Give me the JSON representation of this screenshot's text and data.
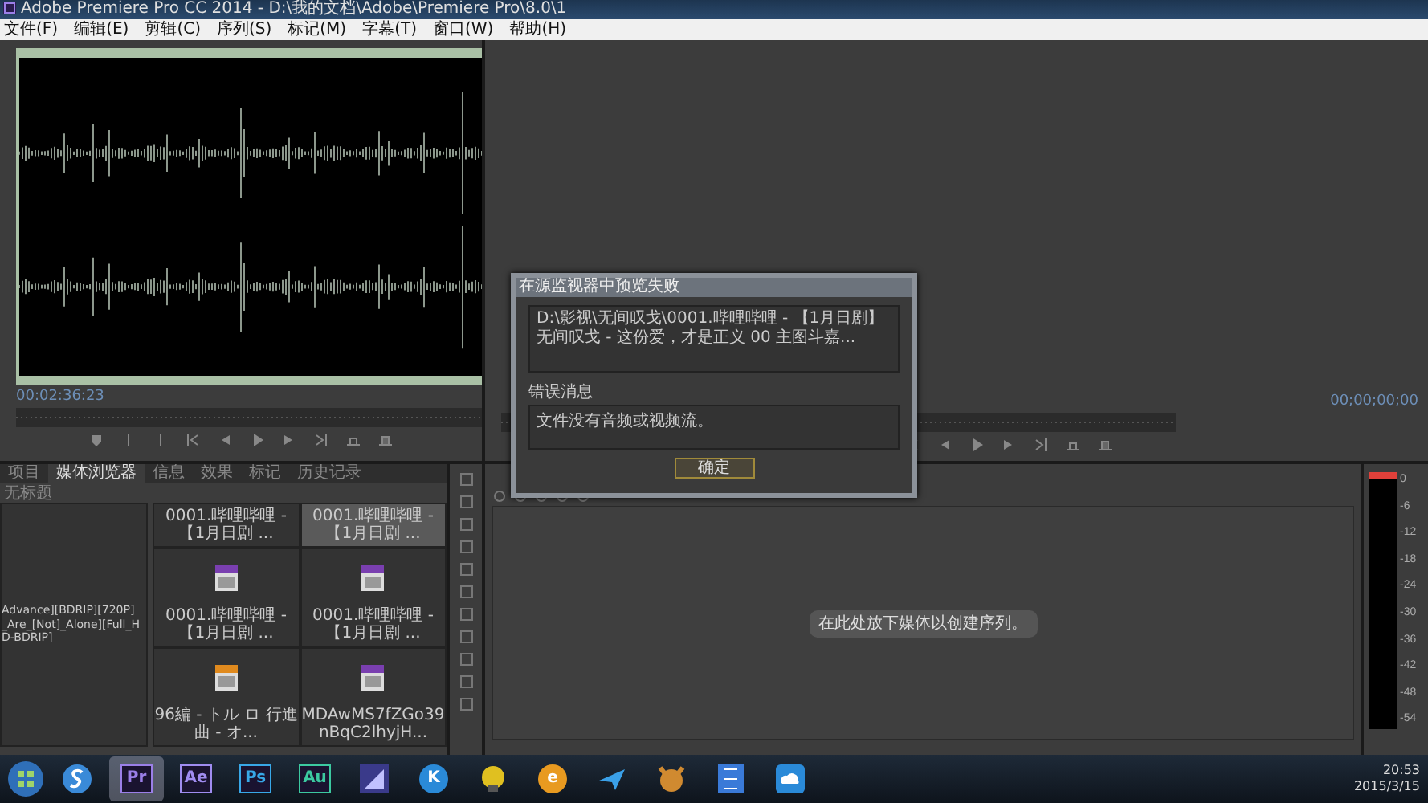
{
  "window": {
    "title": "Adobe Premiere Pro CC 2014 - D:\\我的文档\\Adobe\\Premiere Pro\\8.0\\1"
  },
  "menu": [
    "文件(F)",
    "编辑(E)",
    "剪辑(C)",
    "序列(S)",
    "标记(M)",
    "字幕(T)",
    "窗口(W)",
    "帮助(H)"
  ],
  "source_monitor": {
    "timecode": "00:02:36:23"
  },
  "program_monitor": {
    "timecode": "00;00;00;00"
  },
  "dialog": {
    "title": "在源监视器中预览失败",
    "path": "D:\\影视\\无间叹戈\\0001.哔哩哔哩 - 【1月日剧】无间叹戈 - 这份爱，才是正义 00 主图斗嘉...",
    "error_label": "错误消息",
    "error_message": "文件没有音频或视频流。",
    "button": "确定"
  },
  "project_panel": {
    "tabs": [
      {
        "label": "项目",
        "selected": false
      },
      {
        "label": "媒体浏览器",
        "selected": true
      },
      {
        "label": "信息",
        "selected": false
      },
      {
        "label": "效果",
        "selected": false
      },
      {
        "label": "标记",
        "selected": false
      },
      {
        "label": "历史记录",
        "selected": false
      }
    ],
    "location": "无标题",
    "tree_item": [
      "Advance][BDRIP][720P]",
      "_Are_[Not]_Alone][Full_HD-BDRIP]"
    ],
    "items": [
      {
        "label": "0001.哔哩哔哩 - 【1月日剧 ...",
        "kind": "clip",
        "selected": false
      },
      {
        "label": "0001.哔哩哔哩 - 【1月日剧 ...",
        "kind": "clip",
        "selected": true
      },
      {
        "label": "0001.哔哩哔哩 - 【1月日剧 ...",
        "kind": "file",
        "color": "#7a3fb0",
        "selected": false
      },
      {
        "label": "0001.哔哩哔哩 - 【1月日剧 ...",
        "kind": "file",
        "color": "#7a3fb0",
        "selected": false
      },
      {
        "label": "96編 - トル ロ 行進曲 - オ...",
        "kind": "file",
        "color": "#e08a1e",
        "selected": false
      },
      {
        "label": "MDAwMS7fZGo39nBqC2lhyjH...",
        "kind": "file",
        "color": "#7a3fb0",
        "selected": false
      }
    ]
  },
  "timeline": {
    "message": "在此处放下媒体以创建序列。"
  },
  "audio_meter": {
    "level": 0.97,
    "ticks": [
      "0",
      "-6",
      "-12",
      "-18",
      "-24",
      "-30",
      "-36",
      "-42",
      "-48",
      "-54"
    ]
  },
  "taskbar": {
    "apps": [
      {
        "kind": "sogou",
        "active": false
      },
      {
        "kind": "letter",
        "label": "Pr",
        "color": "#9b7fe8",
        "active": true
      },
      {
        "kind": "letter",
        "label": "Ae",
        "color": "#a08cf0",
        "active": false
      },
      {
        "kind": "letter",
        "label": "Ps",
        "color": "#38a8e8",
        "active": false
      },
      {
        "kind": "letter",
        "label": "Au",
        "color": "#3cc9a0",
        "active": false
      },
      {
        "kind": "chart",
        "active": false
      },
      {
        "kind": "circle",
        "label": "K",
        "color": "#2a8ad8",
        "active": false
      },
      {
        "kind": "bulb",
        "active": false
      },
      {
        "kind": "circle",
        "label": "e",
        "color": "#e89a20",
        "active": false
      },
      {
        "kind": "bird",
        "active": false
      },
      {
        "kind": "fox",
        "active": false
      },
      {
        "kind": "film",
        "active": false
      },
      {
        "kind": "cloud",
        "active": false
      }
    ],
    "time": "20:53",
    "date": "2015/3/15"
  }
}
